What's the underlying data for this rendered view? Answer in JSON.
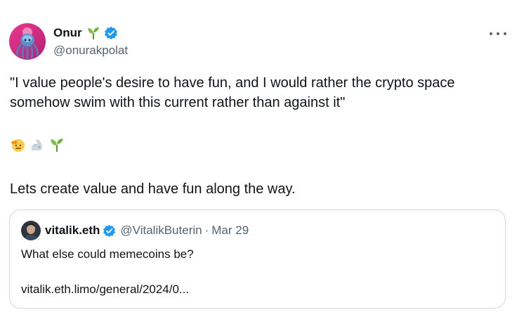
{
  "author": {
    "display_name": "Onur",
    "handle": "@onurakpolat"
  },
  "tweet": {
    "text": "\"I value people's desire to have fun, and I would rather the crypto space somehow swim with this current rather than against it\"",
    "emoji_icons": [
      "saluting-face-icon",
      "mechanical-arm-icon",
      "seedling-icon"
    ],
    "second_text": "Lets create value and have fun along the way."
  },
  "quoted": {
    "display_name": "vitalik.eth",
    "handle": "@VitalikButerin",
    "separator": "·",
    "date": "Mar 29",
    "text": "What else could memecoins be?",
    "link": "vitalik.eth.limo/general/2024/0..."
  },
  "colors": {
    "verified_blue": "#1d9bf0",
    "secondary_text": "#536471",
    "border": "#cfd9de"
  }
}
